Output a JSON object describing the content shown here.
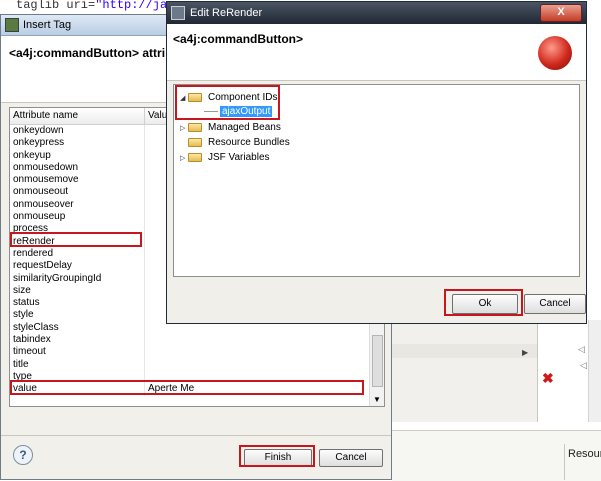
{
  "background": {
    "code_line": "taglib uri=",
    "code_string": "\"http://ja"
  },
  "insert_tag": {
    "title": "Insert Tag",
    "header": "<a4j:commandButton> attri",
    "columns": [
      "Attribute name",
      "Valu"
    ],
    "rows": [
      {
        "name": "onkeydown",
        "value": ""
      },
      {
        "name": "onkeypress",
        "value": ""
      },
      {
        "name": "onkeyup",
        "value": ""
      },
      {
        "name": "onmousedown",
        "value": ""
      },
      {
        "name": "onmousemove",
        "value": ""
      },
      {
        "name": "onmouseout",
        "value": ""
      },
      {
        "name": "onmouseover",
        "value": ""
      },
      {
        "name": "onmouseup",
        "value": ""
      },
      {
        "name": "process",
        "value": ""
      },
      {
        "name": "reRender",
        "value": ""
      },
      {
        "name": "rendered",
        "value": ""
      },
      {
        "name": "requestDelay",
        "value": ""
      },
      {
        "name": "similarityGroupingId",
        "value": ""
      },
      {
        "name": "size",
        "value": ""
      },
      {
        "name": "status",
        "value": ""
      },
      {
        "name": "style",
        "value": ""
      },
      {
        "name": "styleClass",
        "value": ""
      },
      {
        "name": "tabindex",
        "value": ""
      },
      {
        "name": "timeout",
        "value": ""
      },
      {
        "name": "title",
        "value": ""
      },
      {
        "name": "type",
        "value": ""
      },
      {
        "name": "value",
        "value": "Aperte Me"
      }
    ],
    "help": "?",
    "finish": "Finish",
    "cancel": "Cancel"
  },
  "rerender": {
    "title": "Edit ReRender",
    "close": "X",
    "header": "<a4j:commandButton>",
    "tree": [
      {
        "label": "Component IDs",
        "expanded": true,
        "children": [
          "ajaxOutput"
        ]
      },
      {
        "label": "Managed Beans",
        "expanded": false
      },
      {
        "label": "Resource Bundles",
        "expanded": false
      },
      {
        "label": "JSF Variables",
        "expanded": false
      }
    ],
    "ok": "Ok",
    "cancel": "Cancel"
  },
  "side_panel": {
    "resource_label": "Resourc"
  },
  "colors": {
    "highlight": "#c8161d",
    "selection": "#3399ff"
  }
}
